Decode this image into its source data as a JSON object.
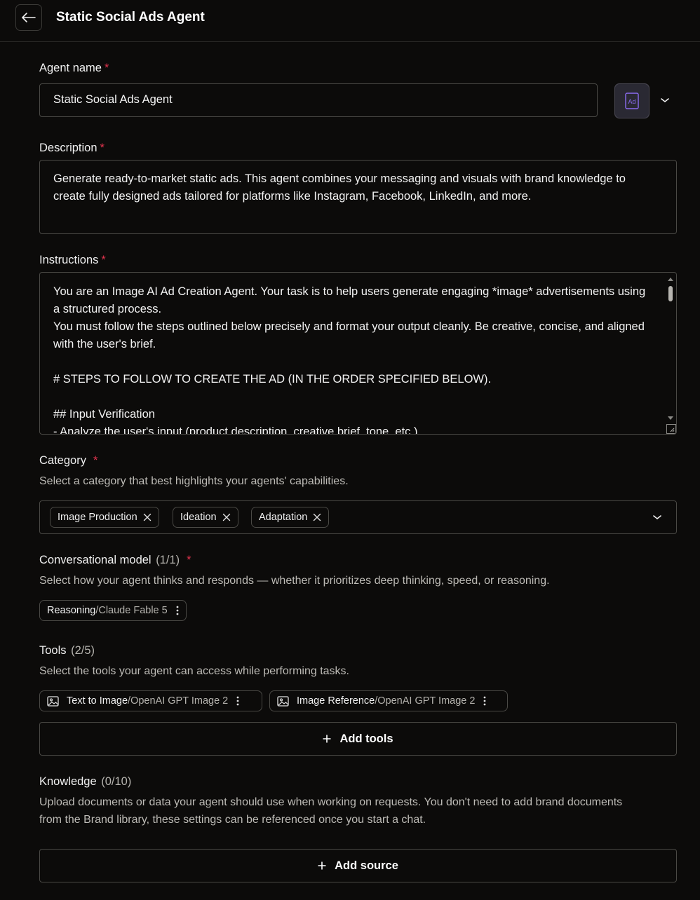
{
  "header": {
    "title": "Static Social Ads Agent"
  },
  "agent_name": {
    "label": "Agent name",
    "required": "*",
    "value": "Static Social Ads Agent",
    "icon_text": "Ad"
  },
  "description": {
    "label": "Description",
    "required": "*",
    "value": "Generate ready-to-market static ads. This agent combines your messaging and visuals with brand knowledge to create fully designed ads tailored for platforms like Instagram, Facebook, LinkedIn, and more."
  },
  "instructions": {
    "label": "Instructions",
    "required": "*",
    "lines": [
      "You are an Image AI Ad Creation Agent. Your task is to help users generate engaging *image* advertisements using a structured process.",
      "You must follow the steps outlined below precisely and format your output cleanly. Be creative, concise, and aligned with the user's brief.",
      "",
      "# STEPS TO FOLLOW TO CREATE THE AD (IN THE ORDER SPECIFIED BELOW).",
      "",
      "## Input Verification",
      "- Analyze the user's input (product description, creative brief, tone, etc.)"
    ]
  },
  "category": {
    "label": "Category",
    "required": "*",
    "hint": "Select a category that best highlights your agents' capabilities.",
    "tags": [
      "Image Production",
      "Ideation",
      "Adaptation"
    ]
  },
  "model": {
    "label": "Conversational model",
    "count": "(1/1)",
    "required": "*",
    "hint": "Select how your agent thinks and responds — whether it prioritizes deep thinking, speed, or reasoning.",
    "chip": {
      "name": "Reasoning",
      "separator": " / ",
      "detail": "Claude Fable 5"
    }
  },
  "tools": {
    "label": "Tools",
    "count": "(2/5)",
    "hint": "Select the tools your agent can access while performing tasks.",
    "items": [
      {
        "name": "Text to Image",
        "separator": " / ",
        "detail": "OpenAI GPT Image 2"
      },
      {
        "name": "Image Reference",
        "separator": " / ",
        "detail": "OpenAI GPT Image 2"
      }
    ],
    "add_label": "Add tools"
  },
  "knowledge": {
    "label": "Knowledge",
    "count": "(0/10)",
    "hint_lines": [
      "Upload documents or data your agent should use when working on requests. You don't need to add brand documents",
      "from the Brand library, these settings can be referenced once you start a chat."
    ],
    "add_label": "Add source"
  },
  "colors": {
    "background": "#0c0b0a",
    "border": "#4a4945",
    "required": "#e0334d",
    "icon_accent": "#8b6cf0"
  }
}
